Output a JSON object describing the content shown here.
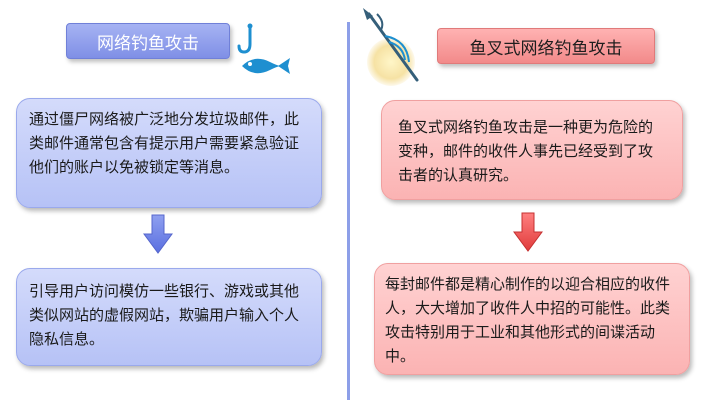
{
  "left": {
    "title": "网络钓鱼攻击",
    "card1_text": "通过僵尸网络被广泛地分发垃圾邮件，此类邮件通常包含有提示用户需要紧急验证他们的账户以免被锁定等消息。",
    "card2_text": "引导用户访问模仿一些银行、游戏或其他类似网站的虚假网站，欺骗用户输入个人隐私信息。"
  },
  "right": {
    "title": "鱼叉式网络钓鱼攻击",
    "card1_text": "鱼叉式网络钓鱼攻击是一种更为危险的变种，邮件的收件人事先已经受到了攻击者的认真研究。",
    "card2_text": "每封邮件都是精心制作的以迎合相应的收件人，大大增加了收件人中招的可能性。此类攻击特别用于工业和其他形式的间谍活动中。"
  },
  "colors": {
    "blue_accent": "#7f8fe6",
    "red_accent": "#f28a8a",
    "hook_icon": "#1e8fd0"
  },
  "icons": {
    "left": "hook-fish-icon",
    "right": "spear-icon"
  }
}
